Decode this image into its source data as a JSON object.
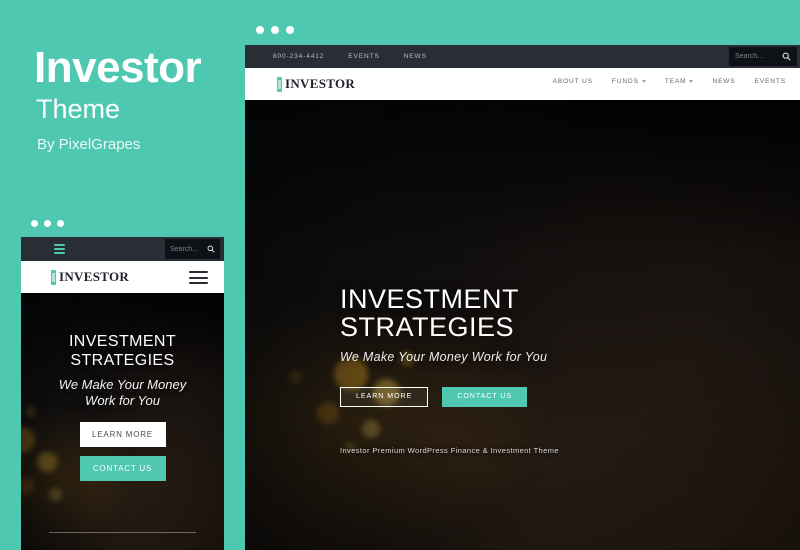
{
  "promo": {
    "title": "Investor",
    "subtitle": "Theme",
    "byline": "By PixelGrapes",
    "accent_color": "#4ec8b0"
  },
  "mobile": {
    "window_dots": 3,
    "topbar": {
      "menu_icon": "hamburger-icon",
      "search_placeholder": "Search...",
      "search_icon": "search-icon"
    },
    "header": {
      "logo_text": "INVESTOR",
      "logo_mark": "bar-chart-mark-icon",
      "menu_icon": "hamburger-icon"
    },
    "hero": {
      "heading_line1": "INVESTMENT",
      "heading_line2": "STRATEGIES",
      "subheading_line1": "We Make Your Money",
      "subheading_line2": "Work for You",
      "button_primary": "LEARN MORE",
      "button_secondary": "CONTACT US"
    }
  },
  "desktop": {
    "window_dots": 3,
    "topbar": {
      "phone": "800-234-4412",
      "links": [
        "EVENTS",
        "NEWS"
      ],
      "search_placeholder": "Search...",
      "search_icon": "search-icon"
    },
    "header": {
      "logo_text": "INVESTOR",
      "logo_mark": "bar-chart-mark-icon",
      "nav": [
        {
          "label": "ABOUT US",
          "has_dropdown": false
        },
        {
          "label": "FUNDS",
          "has_dropdown": true
        },
        {
          "label": "TEAM",
          "has_dropdown": true
        },
        {
          "label": "NEWS",
          "has_dropdown": false
        },
        {
          "label": "EVENTS",
          "has_dropdown": false
        }
      ]
    },
    "hero": {
      "heading_line1": "INVESTMENT",
      "heading_line2": "STRATEGIES",
      "subheading": "We Make Your Money Work for You",
      "button_primary": "LEARN MORE",
      "button_secondary": "CONTACT US",
      "tagline": "Investor Premium WordPress Finance & Investment Theme"
    }
  },
  "colors": {
    "accent": "#4ec8b0",
    "dark_bar": "#282d36",
    "search_bg": "#0e1116",
    "white": "#ffffff"
  }
}
